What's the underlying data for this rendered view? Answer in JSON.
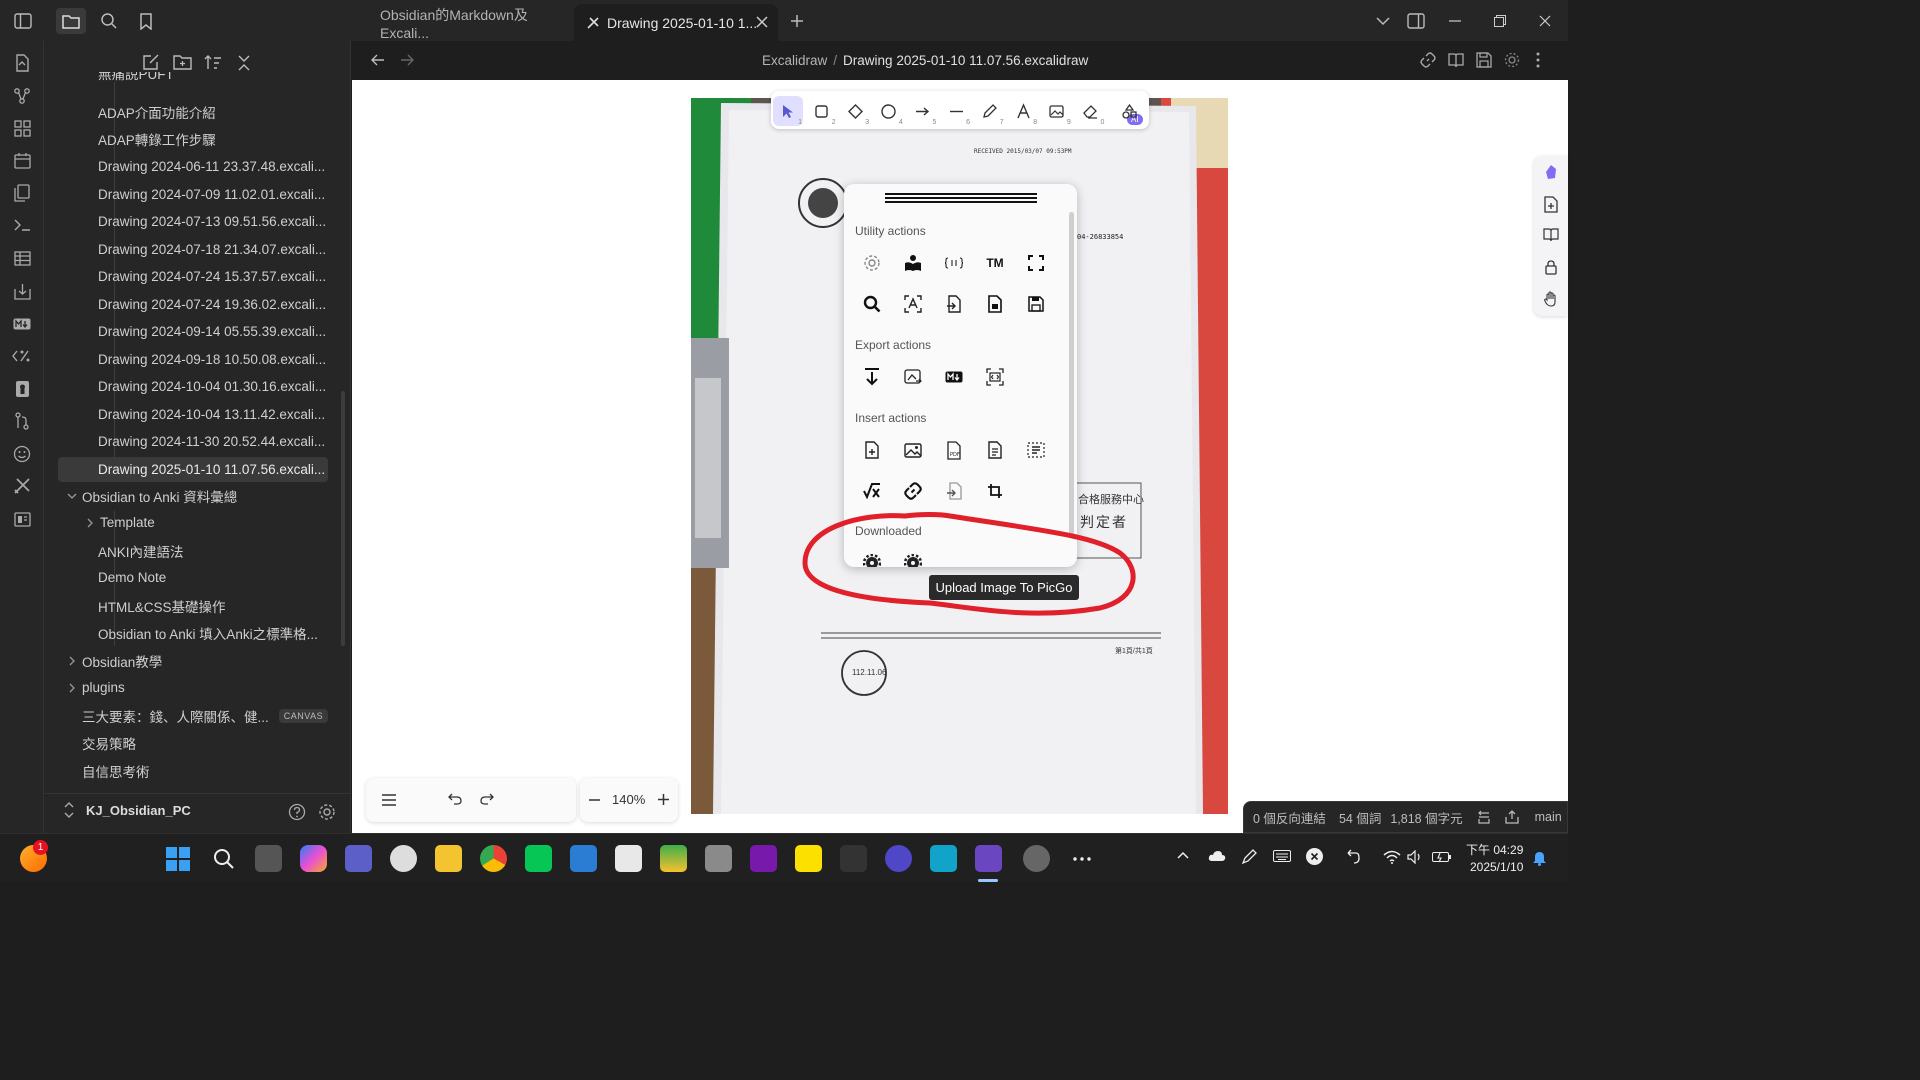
{
  "titlebar": {
    "tabs": [
      {
        "label": "Obsidian的Markdown及Excali..."
      },
      {
        "label": "Drawing 2025-01-10 1..."
      }
    ]
  },
  "header": {
    "breadcrumb_parent": "Excalidraw",
    "breadcrumb_sep": "/",
    "file_name": "Drawing 2025-01-10 11.07.56.excalidraw"
  },
  "sidebar": {
    "partial_top": "無痛說PUFT",
    "items": [
      "ADAP介面功能介紹",
      "ADAP轉錄工作步驟",
      "Drawing 2024-06-11 23.37.48.excali...",
      "Drawing 2024-07-09 11.02.01.excali...",
      "Drawing 2024-07-13 09.51.56.excali...",
      "Drawing 2024-07-18 21.34.07.excali...",
      "Drawing 2024-07-24 15.37.57.excali...",
      "Drawing 2024-07-24 19.36.02.excali...",
      "Drawing 2024-09-14 05.55.39.excali...",
      "Drawing 2024-09-18 10.50.08.excali...",
      "Drawing 2024-10-04 01.30.16.excali...",
      "Drawing 2024-10-04 13.11.42.excali...",
      "Drawing 2024-11-30 20.52.44.excali...",
      "Drawing 2025-01-10 11.07.56.excali..."
    ],
    "folder_anki": "Obsidian to Anki 資料彙總",
    "anki_children": [
      "Template",
      "ANKI內建語法",
      "Demo Note",
      "HTML&CSS基礎操作",
      "Obsidian to Anki 填入Anki之標準格..."
    ],
    "folder_teach": "Obsidian教學",
    "folder_plugins": "plugins",
    "canvas_item": "三大要素：錢、人際關係、健...",
    "canvas_badge": "CANVAS",
    "item_trade": "交易策略",
    "item_confidence": "自信思考術",
    "vault_name": "KJ_Obsidian_PC"
  },
  "excalidraw": {
    "menu_sections": [
      "Utility actions",
      "Export actions",
      "Insert actions",
      "Downloaded"
    ],
    "zoom": "140%",
    "tooltip": "Upload Image To PicGo",
    "toolbar_ai_badge": "AI",
    "tool_numbers": [
      "1",
      "2",
      "3",
      "4",
      "5",
      "6",
      "7",
      "8",
      "9",
      "0"
    ],
    "tm_label": "TM"
  },
  "document_text": {
    "received": "RECEIVED  2015/03/07 09:53PM",
    "ref_number": "04-26833854",
    "stamp_text_1": "合格服務中心",
    "stamp_text_2": "判定者",
    "page_label": "第1頁/共1頁",
    "date_stamp": "112.11.06"
  },
  "statusbar": {
    "backlinks": "0 個反向連結",
    "words": "54 個詞",
    "chars": "1,818 個字元",
    "branch": "main"
  },
  "taskbar": {
    "notification_badge": "1",
    "time": "下午 04:29",
    "date": "2025/1/10"
  },
  "colors": {
    "accent": "#7f6df2",
    "annotation_red": "#e0202a",
    "tool_selected_bg": "#e0dfff"
  }
}
